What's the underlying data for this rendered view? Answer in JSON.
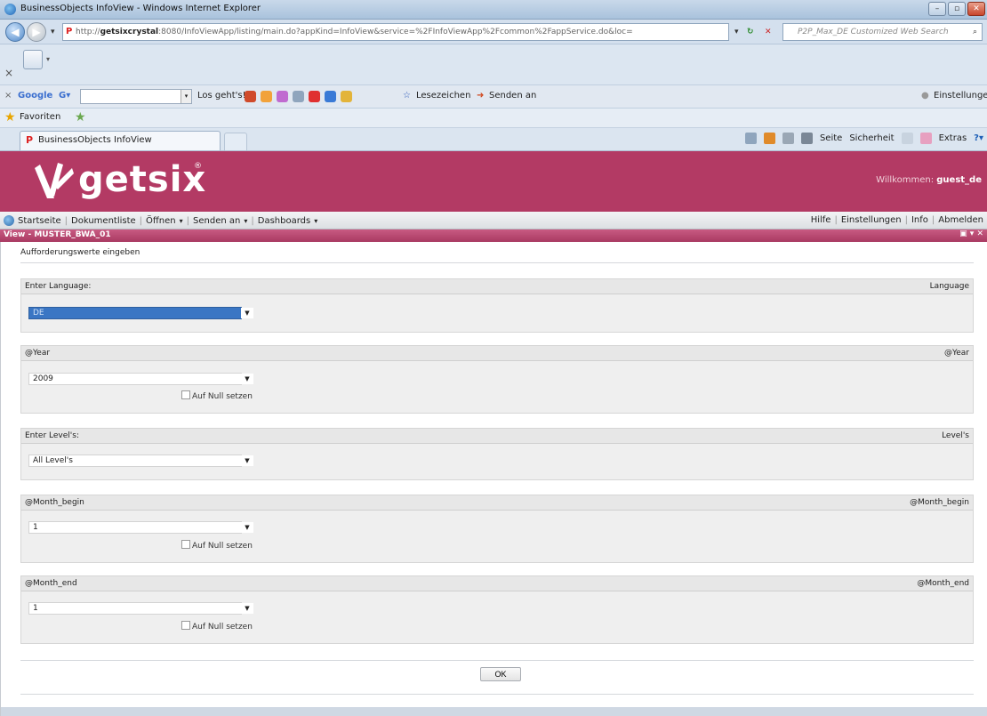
{
  "window": {
    "title": "BusinessObjects InfoView - Windows Internet Explorer"
  },
  "address": {
    "url_prefix": "http://",
    "url_host": "getsixcrystal",
    "url_rest": ":8080/InfoViewApp/listing/main.do?appKind=InfoView&service=%2FInfoViewApp%2Fcommon%2FappService.do&loc=",
    "search_placeholder": "P2P_Max_DE Customized Web Search"
  },
  "google_toolbar": {
    "close": "×",
    "brand": "Google",
    "go_label": "Los geht's!",
    "bookmarks_label": "Lesezeichen",
    "send_label": "Senden an",
    "settings_label": "Einstellungen"
  },
  "favorites": {
    "label": "Favoriten"
  },
  "tabs": {
    "active_label": "BusinessObjects InfoView"
  },
  "command_bar": {
    "page": "Seite",
    "safety": "Sicherheit",
    "extras": "Extras"
  },
  "banner": {
    "logo_text": "getsix",
    "logo_reg": "®",
    "welcome_label": "Willkommen:",
    "user": "guest_de"
  },
  "app_nav": {
    "left": [
      "Startseite",
      "Dokumentliste",
      "Öffnen",
      "Senden an",
      "Dashboards"
    ],
    "right": [
      "Hilfe",
      "Einstellungen",
      "Info",
      "Abmelden"
    ]
  },
  "view": {
    "title": "View - MUSTER_BWA_01",
    "prompt_title": "Aufforderungswerte eingeben",
    "ok_label": "OK",
    "null_label": "Auf Null setzen"
  },
  "sections": [
    {
      "left": "Enter Language:",
      "right": "Language",
      "value": "DE"
    },
    {
      "left": "@Year",
      "right": "@Year",
      "value": "2009"
    },
    {
      "left": "Enter Level's:",
      "right": "Level's",
      "value": "All Level's"
    },
    {
      "left": "@Month_begin",
      "right": "@Month_begin",
      "value": "1"
    },
    {
      "left": "@Month_end",
      "right": "@Month_end",
      "value": "1"
    }
  ],
  "colors": {
    "banner": "#b33a64",
    "view_header": "#b03f68",
    "selection": "#3a76c4"
  }
}
